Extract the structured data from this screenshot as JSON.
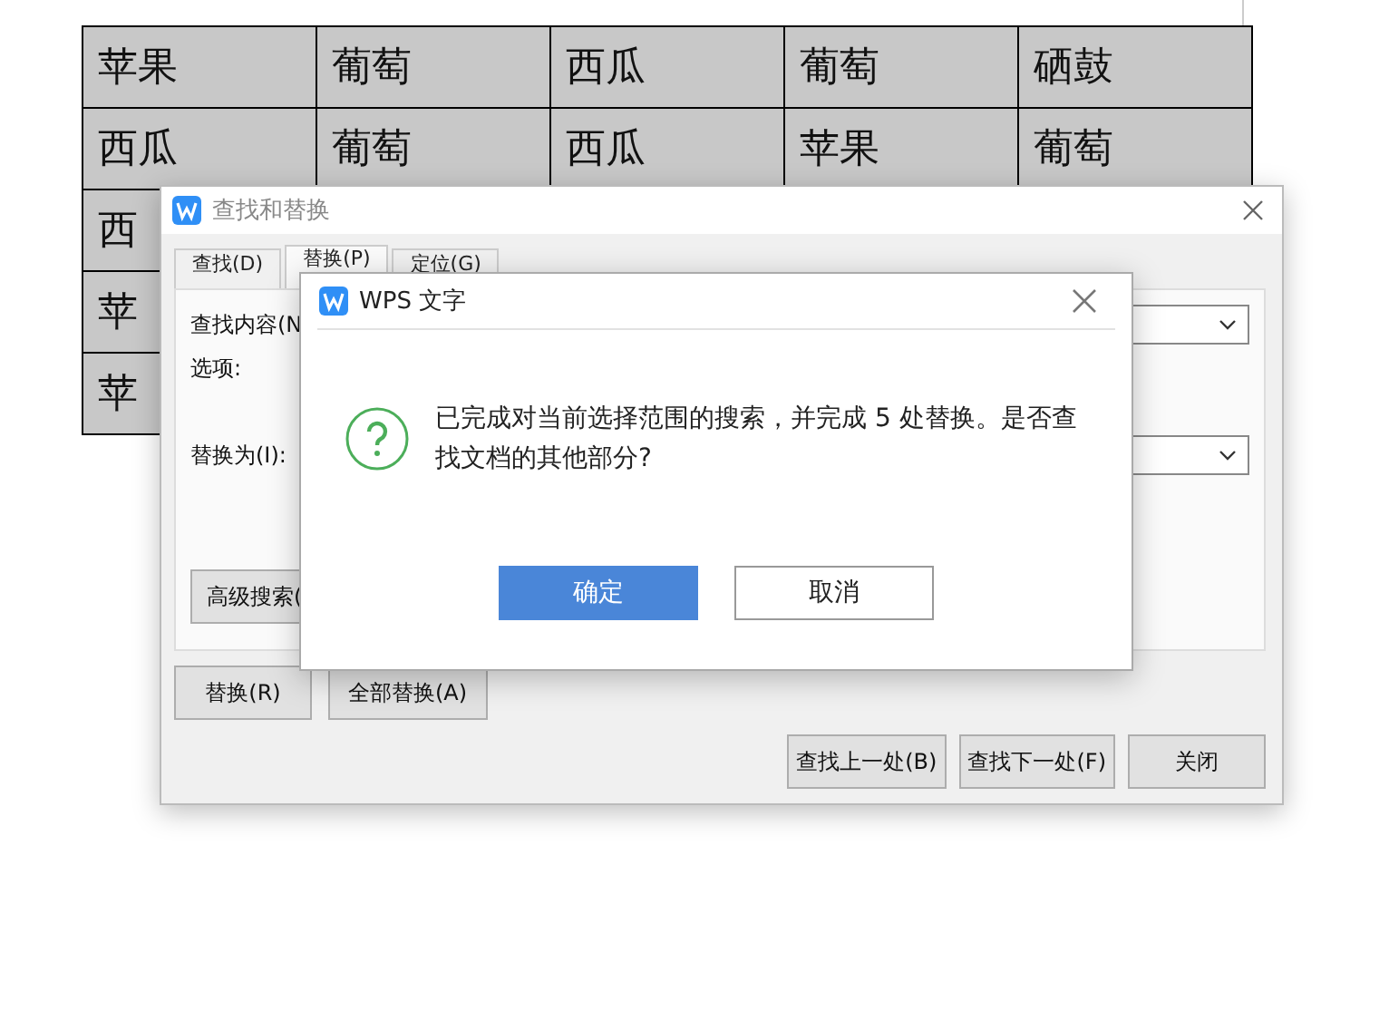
{
  "document": {
    "table": {
      "rows": [
        [
          "苹果",
          "葡萄",
          "西瓜",
          "葡萄",
          "硒鼓"
        ],
        [
          "西瓜",
          "葡萄",
          "西瓜",
          "苹果",
          "葡萄"
        ],
        [
          "西"
        ],
        [
          "苹"
        ],
        [
          "苹"
        ]
      ]
    }
  },
  "find_dialog": {
    "title": "查找和替换",
    "tabs": [
      {
        "label": "查找(D)",
        "selected": false
      },
      {
        "label": "替换(P)",
        "selected": true
      },
      {
        "label": "定位(G)",
        "selected": false
      }
    ],
    "panel_rows": [
      {
        "kind": "field",
        "label": "查找内容(N"
      },
      {
        "kind": "text",
        "label": "选项:"
      },
      {
        "kind": "field",
        "label": "替换为(I):"
      }
    ],
    "advanced_button": "高级搜索(",
    "action_buttons": [
      "替换(R)",
      "全部替换(A)"
    ],
    "footer_buttons": [
      "查找上一处(B)",
      "查找下一处(F)",
      "关闭"
    ]
  },
  "message_dialog": {
    "title": "WPS 文字",
    "message": "已完成对当前选择范围的搜索，并完成 5 处替换。是否查找文档的其他部分?",
    "buttons": [
      {
        "label": "确定",
        "kind": "primary"
      },
      {
        "label": "取消",
        "kind": "secondary"
      }
    ]
  }
}
